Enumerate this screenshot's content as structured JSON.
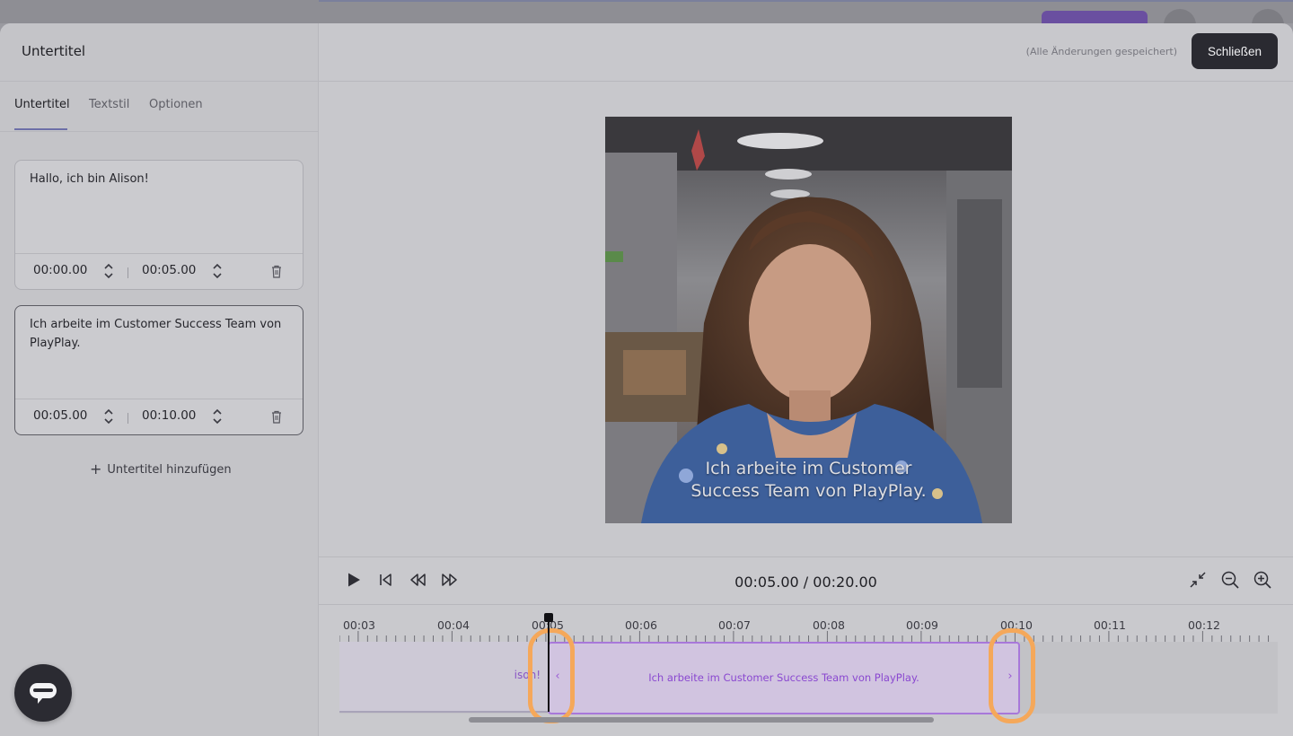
{
  "modal": {
    "title": "Untertitel",
    "saved_status": "(Alle Änderungen gespeichert)",
    "close_label": "Schließen"
  },
  "tabs": [
    {
      "label": "Untertitel",
      "active": true
    },
    {
      "label": "Textstil",
      "active": false
    },
    {
      "label": "Optionen",
      "active": false
    }
  ],
  "subtitles": [
    {
      "text": "Hallo, ich bin Alison!",
      "start": "00:00.00",
      "end": "00:05.00",
      "selected": false
    },
    {
      "text": "Ich arbeite im Customer Success Team von PlayPlay.",
      "start": "00:05.00",
      "end": "00:10.00",
      "selected": true
    }
  ],
  "add_subtitle_label": "Untertitel hinzufügen",
  "preview": {
    "caption_line1": "Ich arbeite im Customer",
    "caption_line2": "Success Team von PlayPlay."
  },
  "player": {
    "timecode": "00:05.00 / 00:20.00",
    "controls": [
      "play-icon",
      "skip-to-start-icon",
      "rewind-icon",
      "fast-forward-icon"
    ],
    "zoom_controls": [
      "collapse-icon",
      "zoom-out-icon",
      "zoom-in-icon"
    ]
  },
  "timeline": {
    "ruler_labels": [
      "00:03",
      "00:04",
      "00:05",
      "00:06",
      "00:07",
      "00:08",
      "00:09",
      "00:10",
      "00:11",
      "00:12"
    ],
    "prev_clip_text": "ison!",
    "active_clip_text": "Ich arbeite im Customer Success Team von PlayPlay.",
    "playhead_time": "00:05.00"
  },
  "colors": {
    "accent_purple": "#a878da",
    "highlight_orange": "#f5a85a",
    "close_button": "#2a2a31"
  }
}
